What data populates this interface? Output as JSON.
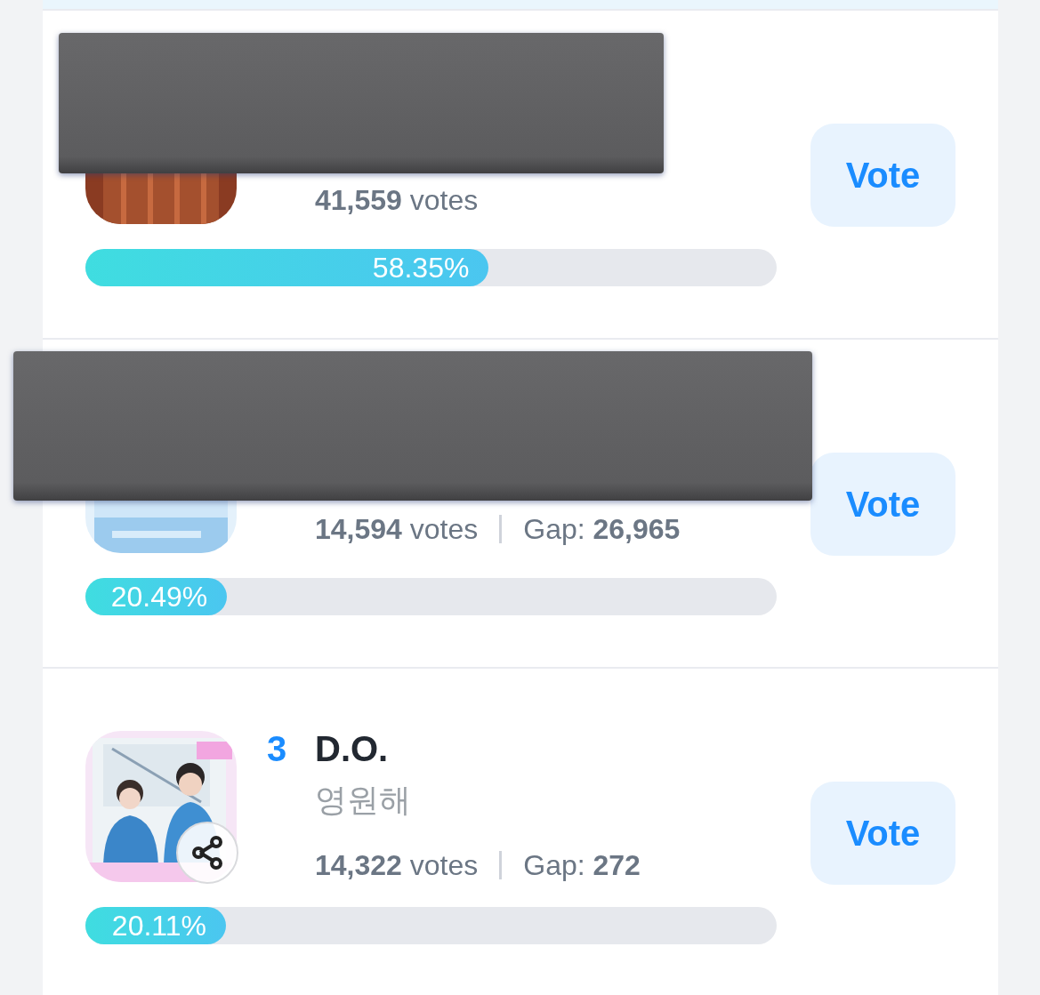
{
  "items": [
    {
      "redacted": true,
      "votes": "41,559",
      "votes_label": "votes",
      "percent": "58.35%",
      "level": 0.5835,
      "button": "Vote"
    },
    {
      "redacted": true,
      "votes": "14,594",
      "votes_label": "votes",
      "gap_label": "Gap:",
      "gap": "26,965",
      "percent": "20.49%",
      "level": 0.2049,
      "button": "Vote"
    },
    {
      "redacted": false,
      "rank": "3",
      "name": "D.O.",
      "song": "영원해",
      "votes": "14,322",
      "votes_label": "votes",
      "gap_label": "Gap:",
      "gap": "272",
      "percent": "20.11%",
      "level": 0.2011,
      "button": "Vote"
    }
  ]
}
